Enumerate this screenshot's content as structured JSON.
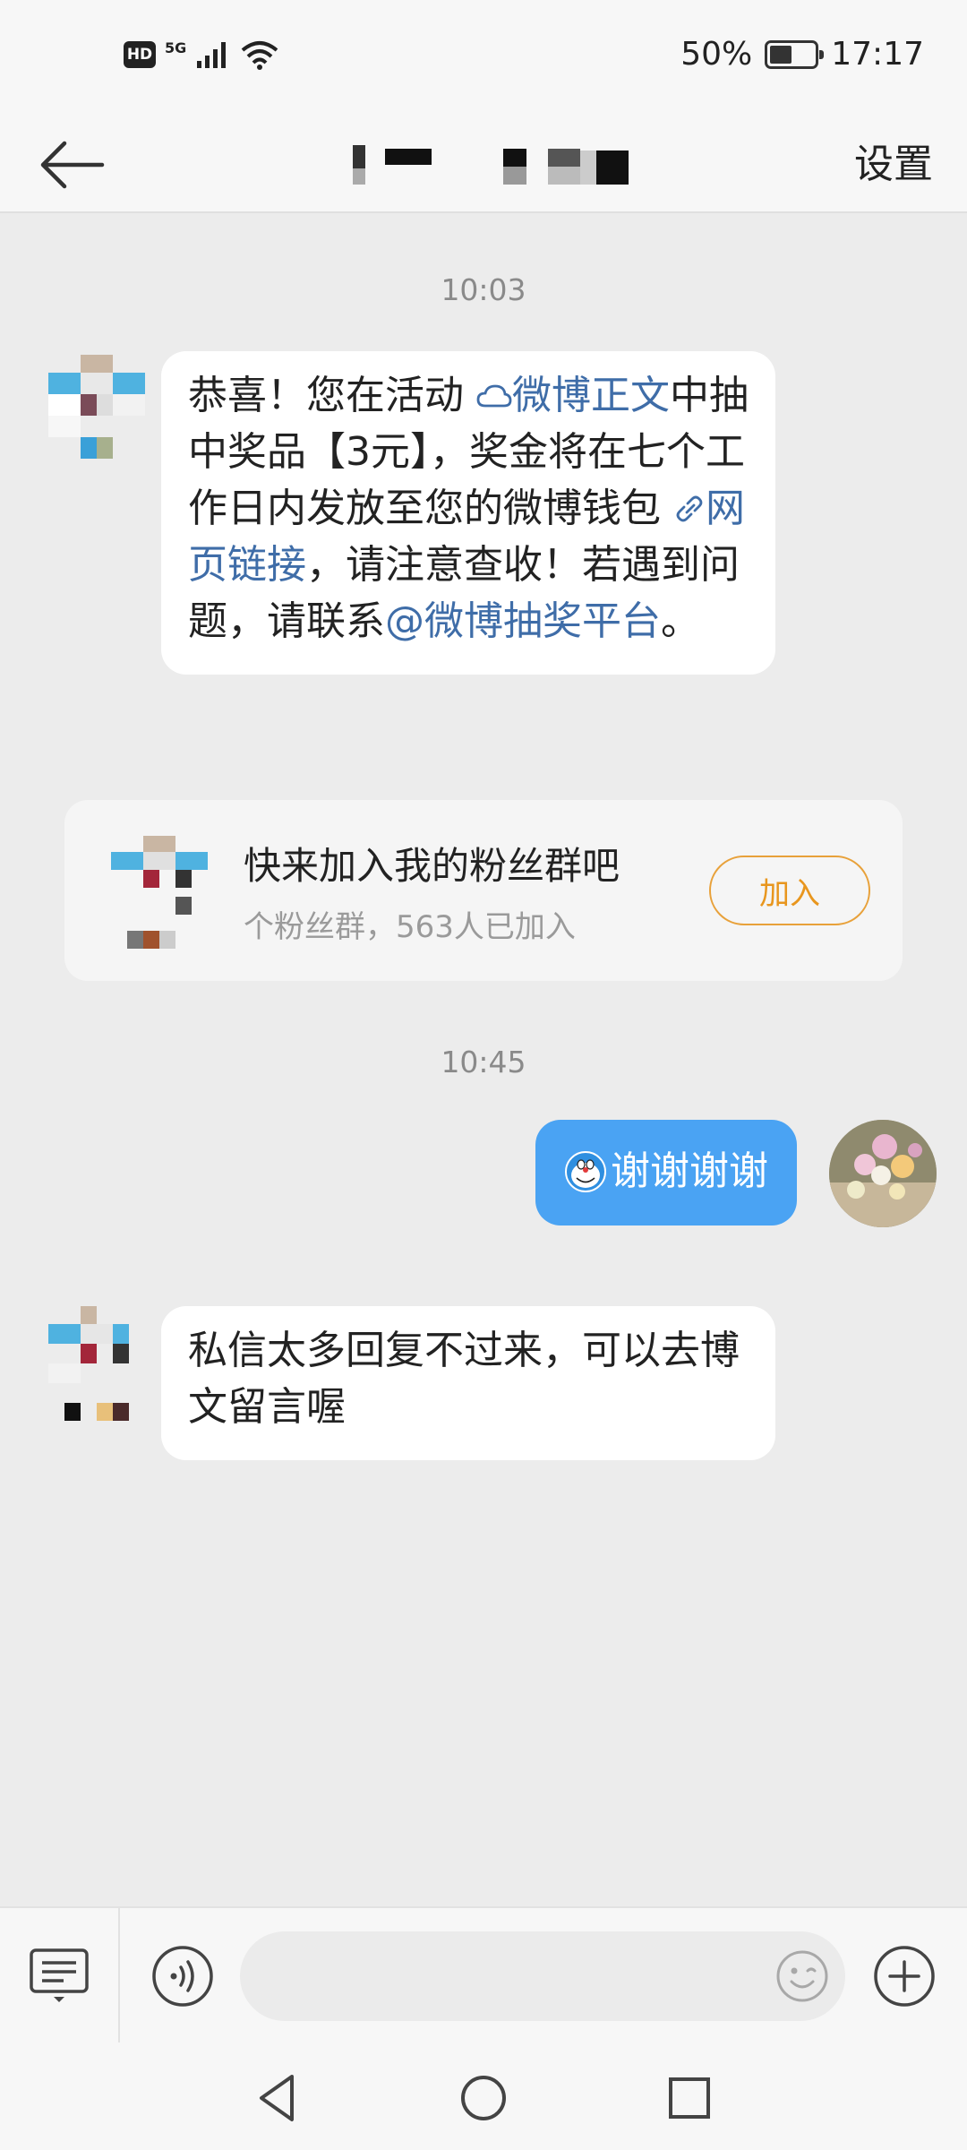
{
  "status_bar": {
    "hd": "HD",
    "network": "5G",
    "battery_text": "50%",
    "battery_level": 0.5,
    "time": "17:17"
  },
  "header": {
    "settings_label": "设置"
  },
  "messages": {
    "time1": "10:03",
    "msg1": {
      "part1": "恭喜！您在活动 ",
      "link1_icon": "cloud-icon",
      "link1": "微博正文",
      "part2": "中抽中奖品【3元】，奖金将在七个工作日内发放至您的微博钱包 ",
      "link2_icon": "link-icon",
      "link2": "网页链接",
      "part3": "，请注意查收！若遇到问题，请联系",
      "mention": "@微博抽奖平台",
      "part4": "。"
    },
    "group_card": {
      "title": "快来加入我的粉丝群吧",
      "subtitle": "个粉丝群，563人已加入",
      "join_label": "加入"
    },
    "time2": "10:45",
    "msg_out": {
      "emoji": "doraemon-emoji",
      "text": "谢谢谢谢"
    },
    "msg2": {
      "text": "私信太多回复不过来，可以去博文留言喔"
    }
  },
  "input_bar": {
    "placeholder": ""
  },
  "colors": {
    "accent_blue": "#4aa3f3",
    "link_blue": "#3f6da8",
    "join_orange": "#e8961e",
    "background": "#ececec"
  }
}
